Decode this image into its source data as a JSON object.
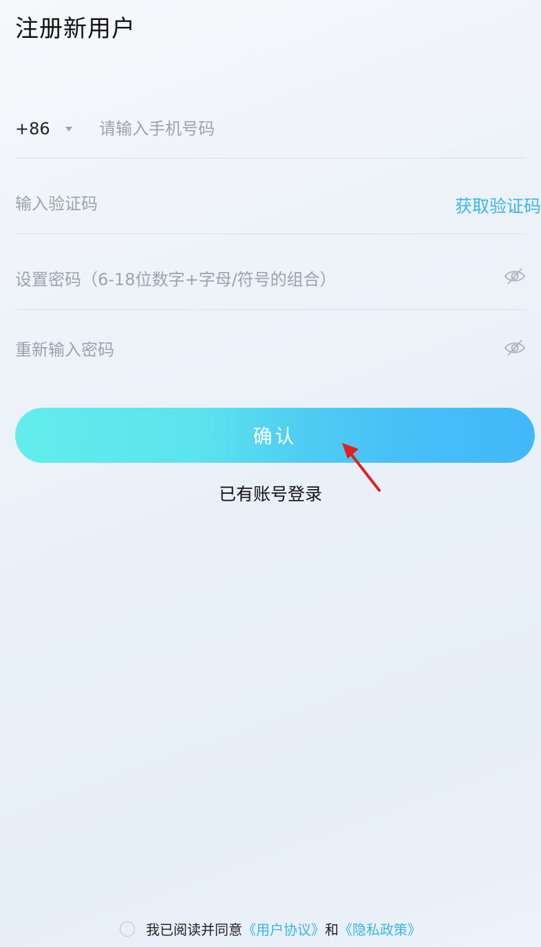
{
  "header": {
    "title": "注册新用户"
  },
  "form": {
    "country_code": "+86",
    "phone_placeholder": "请输入手机号码",
    "code_placeholder": "输入验证码",
    "get_code_label": "获取验证码",
    "password_placeholder": "设置密码（6-18位数字+字母/符号的组合）",
    "password_confirm_placeholder": "重新输入密码"
  },
  "actions": {
    "confirm_label": "确认",
    "login_link": "已有账号登录"
  },
  "agreement": {
    "prefix": "我已阅读并同意",
    "user_agreement": "《用户协议》",
    "and": "和",
    "privacy_policy": "《隐私政策》",
    "checked": false
  },
  "icons": {
    "password_visibility": "eye-off-icon",
    "country_dropdown": "caret-down-icon",
    "annotation": "red-arrow"
  },
  "colors": {
    "accent": "#3ab5e8",
    "button_start": "#62edec",
    "button_end": "#42b8f9",
    "annotation_arrow": "#e02020"
  }
}
